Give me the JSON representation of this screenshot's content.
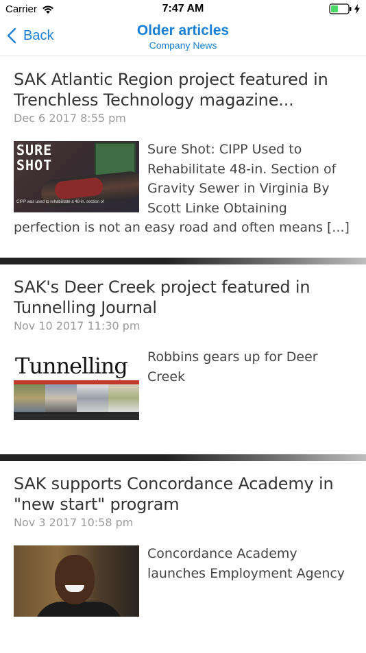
{
  "status_bar": {
    "carrier": "Carrier",
    "time": "7:47 AM"
  },
  "nav": {
    "back_label": "Back",
    "title": "Older articles",
    "subtitle": "Company News"
  },
  "articles": [
    {
      "title": "SAK Atlantic Region project featured in Trenchless Technology magazine...",
      "date": "Dec 6 2017 8:55 pm",
      "excerpt": "Sure Shot: CIPP Used to Rehabilitate 48-in. Section of Gravity Sewer in Virginia By Scott Linke Obtaining perfection is not an easy road and often means [...]",
      "thumb_text": "SURE\nSHOT",
      "thumb_caption": "CIPP was used to rehabilitate a 48-in. section of"
    },
    {
      "title": "SAK's Deer Creek project featured in Tunnelling Journal",
      "date": "Nov 10 2017 11:30 pm",
      "excerpt": "Robbins gears up for Deer Creek",
      "thumb_logo": "Tunnelling",
      "thumb_logo_sub": "journal"
    },
    {
      "title": "SAK supports Concordance Academy in \"new start\" program",
      "date": "Nov 3 2017 10:58 pm",
      "excerpt": "Concordance Academy launches Employment Agency"
    }
  ],
  "colors": {
    "accent": "#1a7fd4",
    "title_text": "#333333",
    "date_text": "#9a9a9a",
    "divider": "#222222"
  }
}
